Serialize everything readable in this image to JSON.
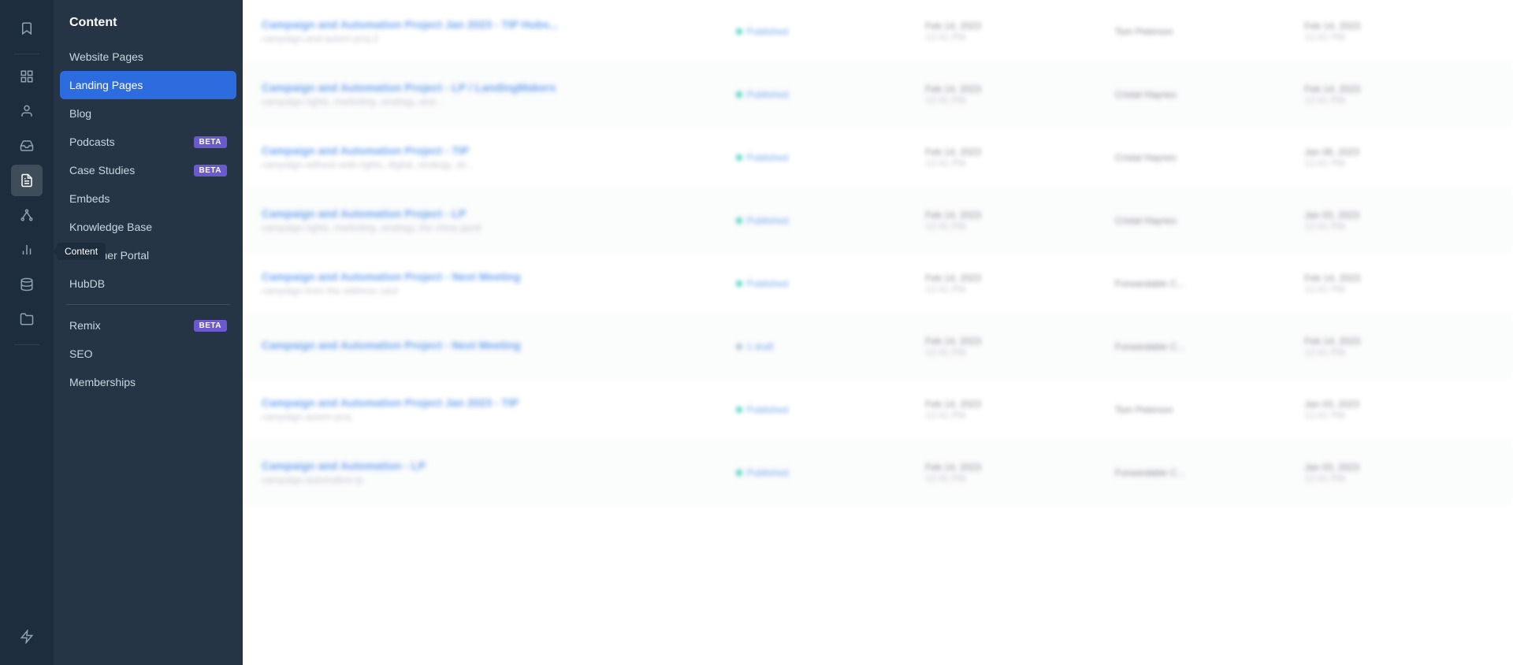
{
  "rail": {
    "icons": [
      {
        "name": "bookmark-icon",
        "symbol": "🔖",
        "active": false
      },
      {
        "name": "divider1",
        "type": "divider"
      },
      {
        "name": "dashboard-icon",
        "symbol": "⊞",
        "active": false
      },
      {
        "name": "contacts-icon",
        "symbol": "👤",
        "active": false
      },
      {
        "name": "inbox-icon",
        "symbol": "✉",
        "active": false
      },
      {
        "name": "content-icon",
        "symbol": "📄",
        "active": true
      },
      {
        "name": "reports-icon",
        "symbol": "📊",
        "active": false
      },
      {
        "name": "database-icon",
        "symbol": "🗄",
        "active": false
      },
      {
        "name": "folder-icon",
        "symbol": "📁",
        "active": false
      },
      {
        "name": "divider2",
        "type": "divider"
      },
      {
        "name": "plus-icon",
        "symbol": "✦",
        "active": false
      }
    ],
    "tooltip": "Content"
  },
  "submenu": {
    "title": "Content",
    "items": [
      {
        "id": "website-pages",
        "label": "Website Pages",
        "active": false,
        "beta": false
      },
      {
        "id": "landing-pages",
        "label": "Landing Pages",
        "active": true,
        "beta": false
      },
      {
        "id": "blog",
        "label": "Blog",
        "active": false,
        "beta": false
      },
      {
        "id": "podcasts",
        "label": "Podcasts",
        "active": false,
        "beta": true
      },
      {
        "id": "case-studies",
        "label": "Case Studies",
        "active": false,
        "beta": true
      },
      {
        "id": "embeds",
        "label": "Embeds",
        "active": false,
        "beta": false
      },
      {
        "id": "knowledge-base",
        "label": "Knowledge Base",
        "active": false,
        "beta": false
      },
      {
        "id": "customer-portal",
        "label": "Customer Portal",
        "active": false,
        "beta": false
      },
      {
        "id": "hubdb",
        "label": "HubDB",
        "active": false,
        "beta": false
      },
      {
        "id": "divider",
        "type": "divider"
      },
      {
        "id": "remix",
        "label": "Remix",
        "active": false,
        "beta": true
      },
      {
        "id": "seo",
        "label": "SEO",
        "active": false,
        "beta": false
      },
      {
        "id": "memberships",
        "label": "Memberships",
        "active": false,
        "beta": false
      }
    ]
  },
  "table": {
    "rows": [
      {
        "title": "Campaign and Automation Project Jan 2023 - TIP Hubs...",
        "subtitle": "campaign-and-autom-proj-2",
        "status": "Published",
        "published_date": "Feb 14, 2023",
        "published_time": "12:41 PM",
        "author": "Tom Peterson",
        "updated_date": "Feb 14, 2023",
        "updated_time": "12:41 PM",
        "is_draft": false
      },
      {
        "title": "Campaign and Automation Project - LP / LandingMakers",
        "subtitle": "campaign-rights, marketing, strategy, and...",
        "status": "Published",
        "published_date": "Feb 14, 2023",
        "published_time": "12:41 PM",
        "author": "Cristal Haynes",
        "updated_date": "Feb 14, 2023",
        "updated_time": "12:41 PM",
        "is_draft": false
      },
      {
        "title": "Campaign and Automation Project - TIP",
        "subtitle": "campaign-without-web-rights, digital, strategy, str...",
        "status": "Published",
        "published_date": "Feb 14, 2023",
        "published_time": "12:41 PM",
        "author": "Cristal Haynes",
        "updated_date": "Jan 06, 2023",
        "updated_time": "12:41 PM",
        "is_draft": false
      },
      {
        "title": "Campaign and Automation Project - LP",
        "subtitle": "campaign-rights, marketing, strategy, the china gantt",
        "status": "Published",
        "published_date": "Feb 14, 2023",
        "published_time": "12:41 PM",
        "author": "Cristal Haynes",
        "updated_date": "Jan 03, 2023",
        "updated_time": "12:41 PM",
        "is_draft": false
      },
      {
        "title": "Campaign and Automation Project - Next Meeting",
        "subtitle": "campaign-from the address card",
        "status": "Published",
        "published_date": "Feb 14, 2023",
        "published_time": "12:41 PM",
        "author": "Forwardable C...",
        "updated_date": "Feb 14, 2023",
        "updated_time": "12:41 PM",
        "is_draft": false
      },
      {
        "title": "Campaign and Automation Project - Next Meeting",
        "subtitle": "",
        "status": "1 draft",
        "published_date": "Feb 14, 2023",
        "published_time": "12:41 PM",
        "author": "Forwardable C...",
        "updated_date": "Feb 14, 2023",
        "updated_time": "12:41 PM",
        "is_draft": true
      },
      {
        "title": "Campaign and Automation Project Jan 2023 - TIP",
        "subtitle": "campaign-autom-proj",
        "status": "Published",
        "published_date": "Feb 14, 2023",
        "published_time": "12:41 PM",
        "author": "Tom Peterson",
        "updated_date": "Jan 03, 2023",
        "updated_time": "12:41 PM",
        "is_draft": false
      },
      {
        "title": "Campaign and Automation - LP",
        "subtitle": "campaign-automation-lp",
        "status": "Published",
        "published_date": "Feb 14, 2023",
        "published_time": "12:41 PM",
        "author": "Forwardable C...",
        "updated_date": "Jan 03, 2023",
        "updated_time": "12:41 PM",
        "is_draft": false
      }
    ]
  },
  "beta_label": "BETA"
}
